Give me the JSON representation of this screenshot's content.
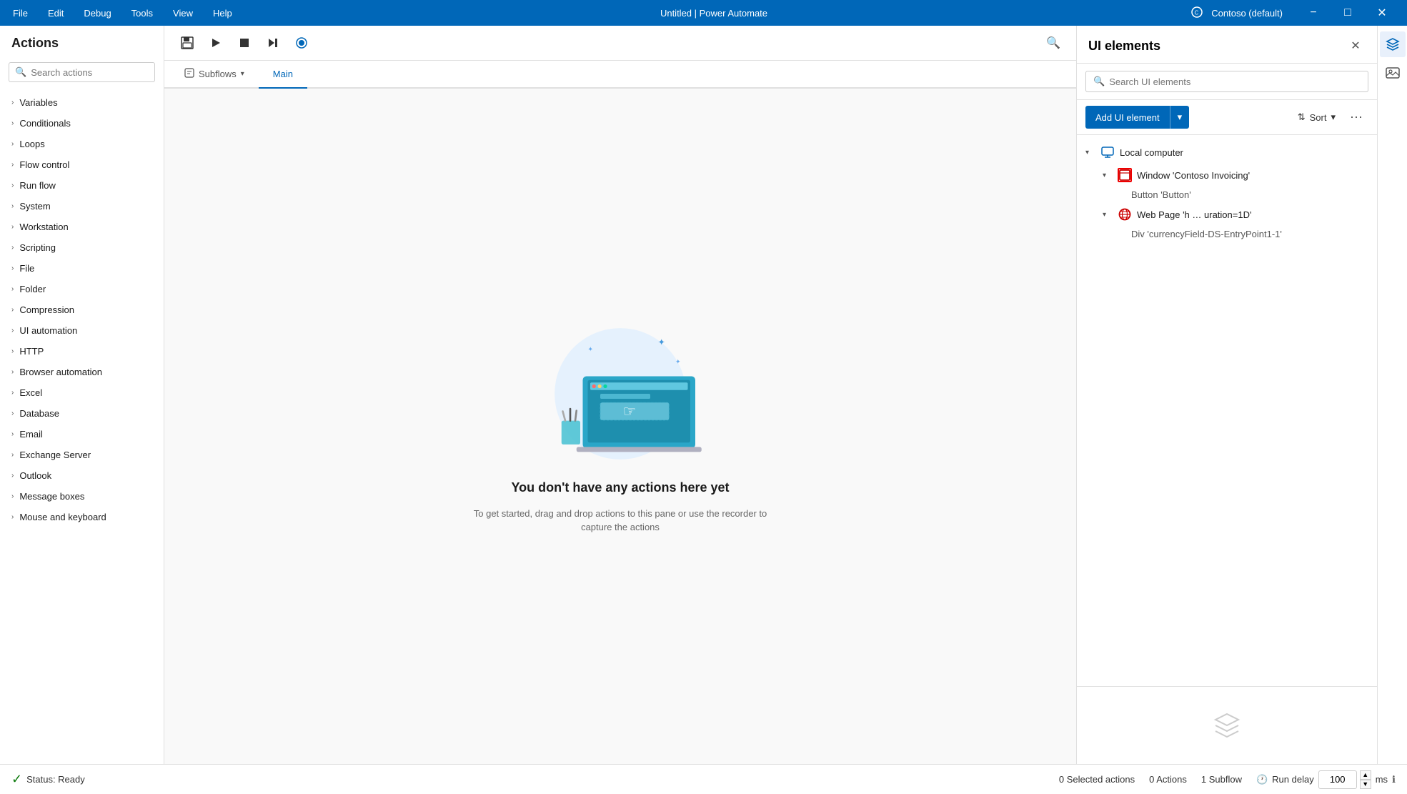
{
  "titleBar": {
    "menu": [
      "File",
      "Edit",
      "Debug",
      "Tools",
      "View",
      "Help"
    ],
    "title": "Untitled | Power Automate",
    "user": "Contoso (default)",
    "controls": [
      "−",
      "□",
      "✕"
    ]
  },
  "actionsPanel": {
    "header": "Actions",
    "searchPlaceholder": "Search actions",
    "items": [
      "Variables",
      "Conditionals",
      "Loops",
      "Flow control",
      "Run flow",
      "System",
      "Workstation",
      "Scripting",
      "File",
      "Folder",
      "Compression",
      "UI automation",
      "HTTP",
      "Browser automation",
      "Excel",
      "Database",
      "Email",
      "Exchange Server",
      "Outlook",
      "Message boxes",
      "Mouse and keyboard"
    ]
  },
  "toolbar": {
    "saveLabel": "💾",
    "playLabel": "▶",
    "stopLabel": "⏹",
    "nextLabel": "⏭",
    "recordLabel": "⏺"
  },
  "tabs": {
    "subflowsLabel": "Subflows",
    "mainLabel": "Main"
  },
  "canvas": {
    "emptyTitle": "You don't have any actions here yet",
    "emptyDesc": "To get started, drag and drop actions to this pane\nor use the recorder to capture the actions"
  },
  "uiElements": {
    "title": "UI elements",
    "searchPlaceholder": "Search UI elements",
    "addButtonLabel": "Add UI element",
    "sortLabel": "Sort",
    "tree": {
      "localComputer": "Local computer",
      "window": "Window 'Contoso Invoicing'",
      "windowChild": "Button 'Button'",
      "webPage": "Web Page 'h … uration=1D'",
      "webPageChild": "Div 'currencyField-DS-EntryPoint1-1'"
    }
  },
  "statusBar": {
    "status": "Status: Ready",
    "selectedActions": "0 Selected actions",
    "actions": "0 Actions",
    "subflow": "1 Subflow",
    "runDelayLabel": "Run delay",
    "runDelayValue": "100",
    "runDelayUnit": "ms"
  }
}
